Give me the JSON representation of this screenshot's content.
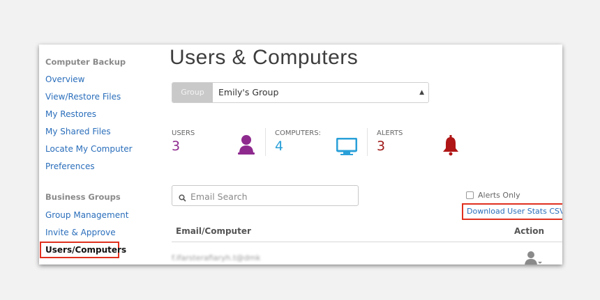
{
  "sidebar": {
    "computer_backup_heading": "Computer Backup",
    "backup_items": [
      {
        "label": "Overview"
      },
      {
        "label": "View/Restore Files"
      },
      {
        "label": "My Restores"
      },
      {
        "label": "My Shared Files"
      },
      {
        "label": "Locate My Computer"
      },
      {
        "label": "Preferences"
      }
    ],
    "business_groups_heading": "Business Groups",
    "group_items": [
      {
        "label": "Group Management"
      },
      {
        "label": "Invite & Approve"
      }
    ],
    "active_item": "Users/Computers"
  },
  "main": {
    "title": "Users & Computers",
    "group_select": {
      "label": "Group",
      "value": "Emily's Group"
    },
    "stats": {
      "users": {
        "label": "USERS",
        "value": "3",
        "color": "#8e2a8e"
      },
      "computers": {
        "label": "COMPUTERS:",
        "value": "4",
        "color": "#2aa0d8"
      },
      "alerts": {
        "label": "ALERTS",
        "value": "3",
        "color": "#a01818"
      }
    },
    "search": {
      "placeholder": "Email Search"
    },
    "alerts_only_label": "Alerts Only",
    "download_csv_label": "Download User Stats CSV",
    "table": {
      "columns": {
        "email": "Email/Computer",
        "action": "Action"
      },
      "rows": [
        {
          "email": "f.ifarsterafiaryh.t@dmk"
        }
      ]
    }
  },
  "colors": {
    "link": "#2a6ebb",
    "highlight": "#e0301e"
  }
}
